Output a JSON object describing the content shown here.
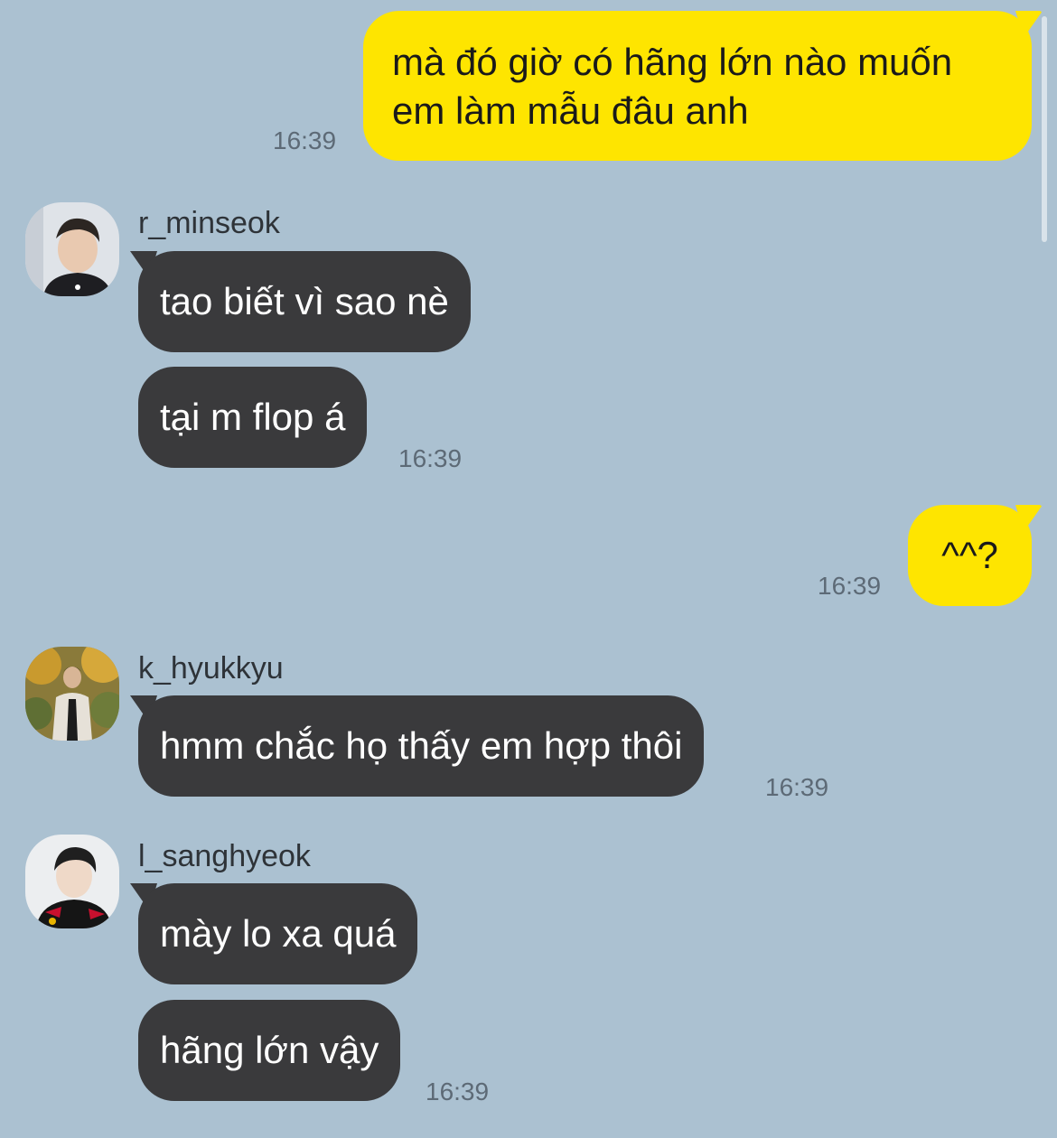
{
  "theme": {
    "background": "#abc1d1",
    "outgoing_bubble": "#fee500",
    "incoming_bubble": "#3a3a3c"
  },
  "messages": {
    "m1": {
      "line1": "mà đó giờ có hãng lớn nào muốn",
      "line2": "em làm mẫu đâu anh",
      "time": "16:39"
    },
    "g1": {
      "sender": "r_minseok",
      "avatar": "minseok-avatar",
      "msg1": "tao biết vì sao nè",
      "msg2": "tại m flop á",
      "time": "16:39"
    },
    "m2": {
      "text": "^^?",
      "time": "16:39"
    },
    "g2": {
      "sender": "k_hyukkyu",
      "avatar": "hyukkyu-avatar",
      "msg1": "hmm chắc họ thấy em hợp thôi",
      "time": "16:39"
    },
    "g3": {
      "sender": "l_sanghyeok",
      "avatar": "sanghyeok-avatar",
      "msg1": "mày lo xa quá",
      "msg2": "hãng lớn vậy",
      "time": "16:39"
    }
  }
}
